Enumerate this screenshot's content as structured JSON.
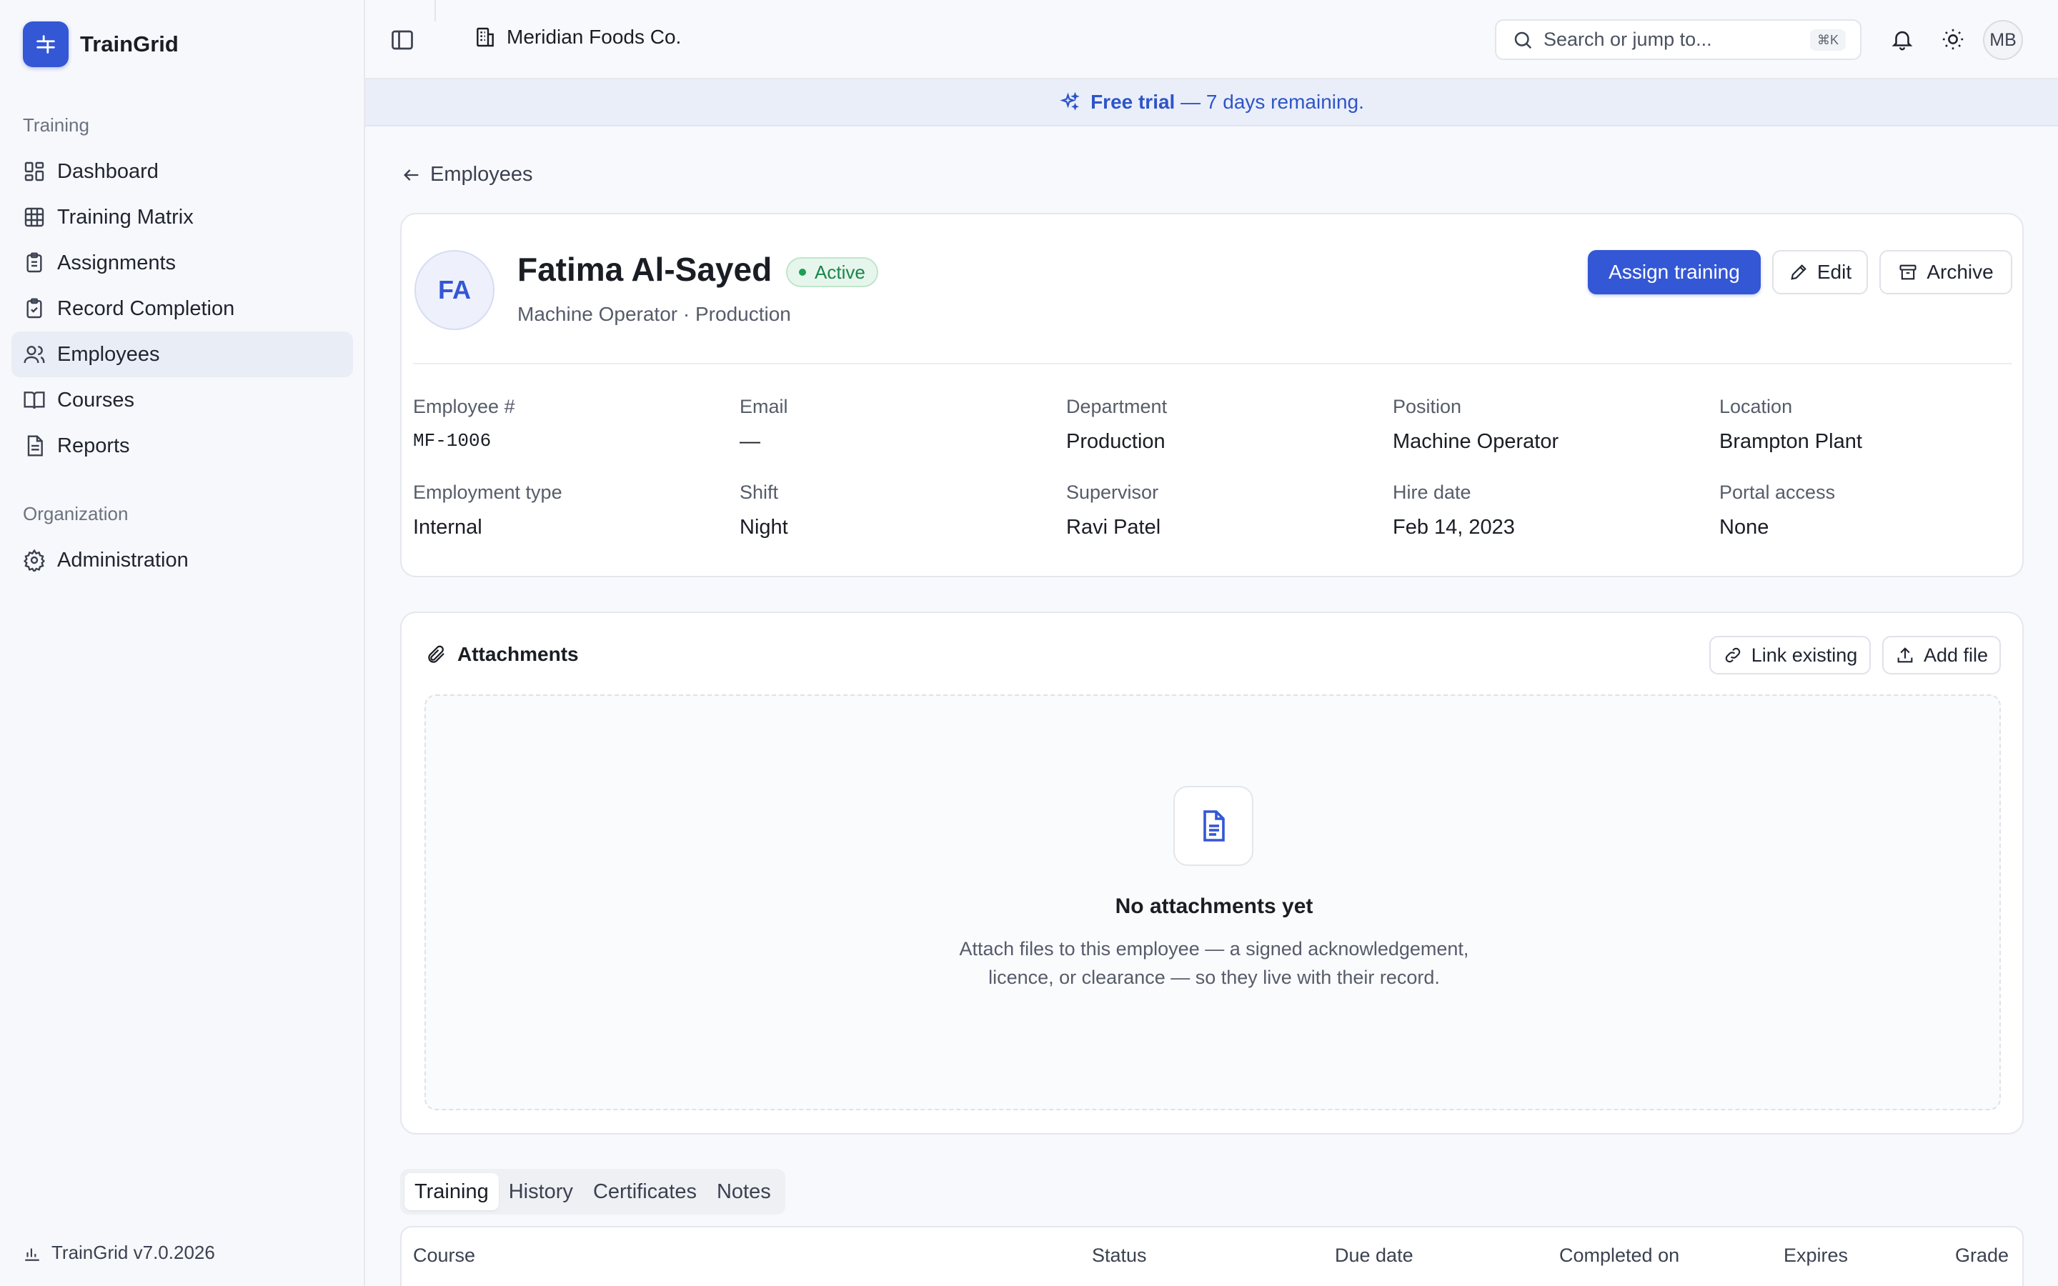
{
  "app": {
    "name": "TrainGrid",
    "version": "TrainGrid v7.0.2026"
  },
  "sidebar": {
    "sections": [
      {
        "title": "Training",
        "items": [
          {
            "label": "Dashboard",
            "icon": "dashboard-icon",
            "active": false
          },
          {
            "label": "Training Matrix",
            "icon": "grid-icon",
            "active": false
          },
          {
            "label": "Assignments",
            "icon": "clipboard-icon",
            "active": false
          },
          {
            "label": "Record Completion",
            "icon": "clipboard-check-icon",
            "active": false
          },
          {
            "label": "Employees",
            "icon": "users-icon",
            "active": true
          },
          {
            "label": "Courses",
            "icon": "book-icon",
            "active": false
          },
          {
            "label": "Reports",
            "icon": "report-icon",
            "active": false
          }
        ]
      },
      {
        "title": "Organization",
        "items": [
          {
            "label": "Administration",
            "icon": "gear-icon",
            "active": false
          }
        ]
      }
    ]
  },
  "topbar": {
    "org_name": "Meridian Foods Co.",
    "search_placeholder": "Search or jump to...",
    "search_shortcut": "⌘K",
    "user_initials": "MB"
  },
  "banner": {
    "strong": "Free trial",
    "text": " — 7 days remaining."
  },
  "breadcrumb": {
    "back_label": "Employees"
  },
  "employee": {
    "initials": "FA",
    "name": "Fatima Al-Sayed",
    "status": "Active",
    "subtitle": "Machine Operator · Production",
    "fields": [
      {
        "label": "Employee #",
        "value": "MF-1006"
      },
      {
        "label": "Email",
        "value": "—"
      },
      {
        "label": "Department",
        "value": "Production"
      },
      {
        "label": "Position",
        "value": "Machine Operator"
      },
      {
        "label": "Location",
        "value": "Brampton Plant"
      },
      {
        "label": "Employment type",
        "value": "Internal"
      },
      {
        "label": "Shift",
        "value": "Night"
      },
      {
        "label": "Supervisor",
        "value": "Ravi Patel"
      },
      {
        "label": "Hire date",
        "value": "Feb 14, 2023"
      },
      {
        "label": "Portal access",
        "value": "None"
      }
    ]
  },
  "actions": {
    "assign": "Assign training",
    "edit": "Edit",
    "archive": "Archive"
  },
  "attachments": {
    "title": "Attachments",
    "link_existing": "Link existing",
    "add_file": "Add file",
    "empty_title": "No attachments yet",
    "empty_desc": "Attach files to this employee — a signed acknowledgement, licence, or clearance — so they live with their record."
  },
  "tabs": [
    {
      "label": "Training",
      "active": true
    },
    {
      "label": "History",
      "active": false
    },
    {
      "label": "Certificates",
      "active": false
    },
    {
      "label": "Notes",
      "active": false
    }
  ],
  "table": {
    "columns": [
      "Course",
      "Status",
      "Due date",
      "Completed on",
      "Expires",
      "Grade"
    ]
  },
  "colors": {
    "accent": "#3457d5",
    "active_status": "#18864a",
    "banner_bg": "#e9eef9"
  }
}
